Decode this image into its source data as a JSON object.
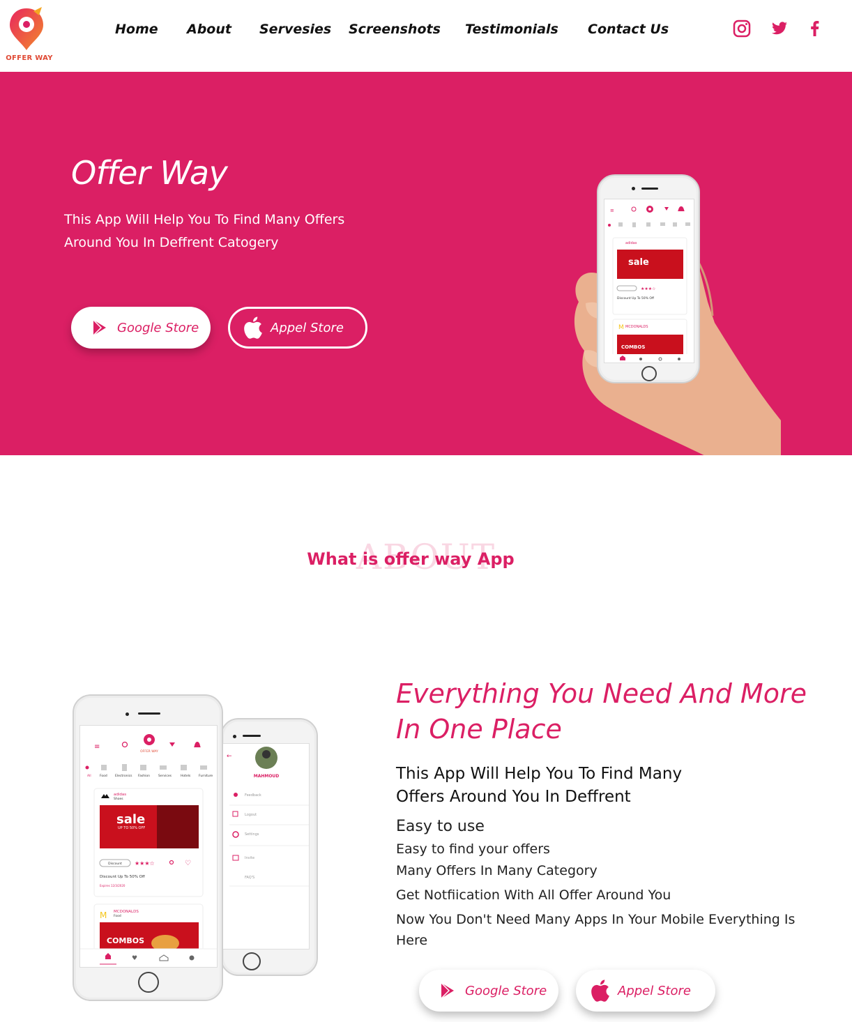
{
  "brand": {
    "name": "OFFER WAY",
    "accent": "#db1f64",
    "logo_icon": "location-pin-logo-icon"
  },
  "nav": {
    "items": [
      {
        "label": "Home"
      },
      {
        "label": "About"
      },
      {
        "label": "Servesies"
      },
      {
        "label": "Screenshots"
      },
      {
        "label": "Testimonials"
      },
      {
        "label": "Contact Us"
      }
    ],
    "social": [
      "instagram-icon",
      "twitter-icon",
      "facebook-icon"
    ]
  },
  "hero": {
    "title": "Offer Way",
    "description": "This App Will Help You To Find Many Offers Around You In Deffrent Catogery",
    "google_label": "Google Store",
    "apple_label": "Appel Store",
    "phone_screen": {
      "categories": [
        "All",
        "Food",
        "Electronics",
        "Fashion",
        "Services",
        "Hotels",
        "Furniture"
      ],
      "card1": {
        "brand": "adidas",
        "category": "Shoes",
        "banner": "sale",
        "banner_sub": "UP TO 50% OFF",
        "tag": "Discount",
        "text": "Discount Up To 50% Off",
        "expires": "Expires 12/3/2020"
      },
      "card2": {
        "brand": "MCDONALDS",
        "category": "Food",
        "banner": "COMBOS"
      }
    }
  },
  "about": {
    "ghost_title": "ABOUT",
    "subtitle": "What is offer way App",
    "heading": "Everything You Need And More In One Place",
    "description": "This App Will Help You To Find Many Offers Around You In Deffrent",
    "features": [
      "Easy to use",
      "Easy to find your offers",
      "Many Offers In Many Category",
      "Get Notfiication With All Offer Around You",
      "Now You Don't Need Many Apps In Your Mobile Everything Is Here"
    ],
    "google_label": "Google Store",
    "apple_label": "Appel Store",
    "menu_phone": {
      "user": "MAHMOUD",
      "items": [
        "Feedback",
        "Logout",
        "Settings",
        "Invite",
        "FAQ'S"
      ]
    }
  }
}
